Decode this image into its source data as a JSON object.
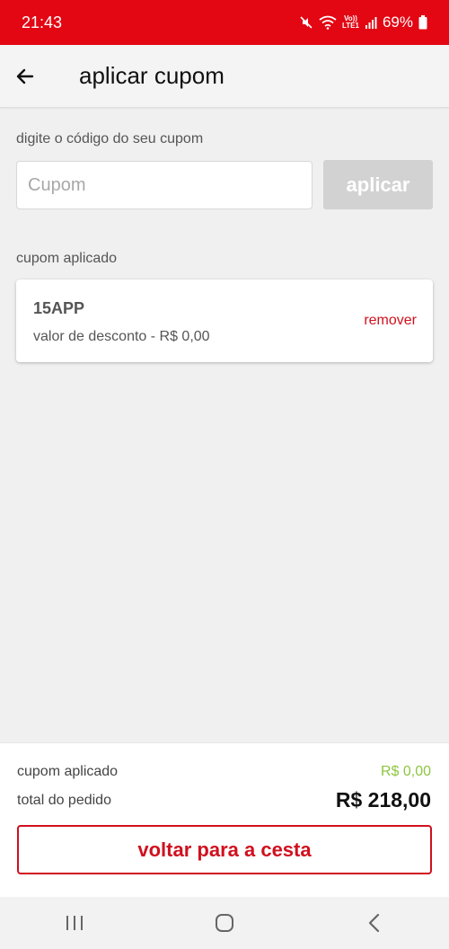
{
  "status_bar": {
    "time": "21:43",
    "network_label_top": "Vo))",
    "network_label_bottom": "LTE1",
    "battery": "69%"
  },
  "header": {
    "title": "aplicar cupom",
    "back_icon": "arrow-left-icon"
  },
  "coupon_form": {
    "label": "digite o código do seu cupom",
    "placeholder": "Cupom",
    "value": "",
    "apply_label": "aplicar"
  },
  "applied_coupon": {
    "section_label": "cupom aplicado",
    "code": "15APP",
    "discount_text": "valor de desconto - R$ 0,00",
    "remove_label": "remover"
  },
  "summary": {
    "coupon_label": "cupom aplicado",
    "coupon_value": "R$ 0,00",
    "total_label": "total do pedido",
    "total_value": "R$ 218,00",
    "back_button_label": "voltar para a cesta"
  },
  "nav_bar": {
    "icons": [
      "recent-apps-icon",
      "home-icon",
      "back-icon"
    ]
  },
  "colors": {
    "brand_red": "#e30613",
    "action_red": "#d0101e",
    "success_green": "#8dc63f",
    "disabled_gray": "#d2d2d2"
  }
}
